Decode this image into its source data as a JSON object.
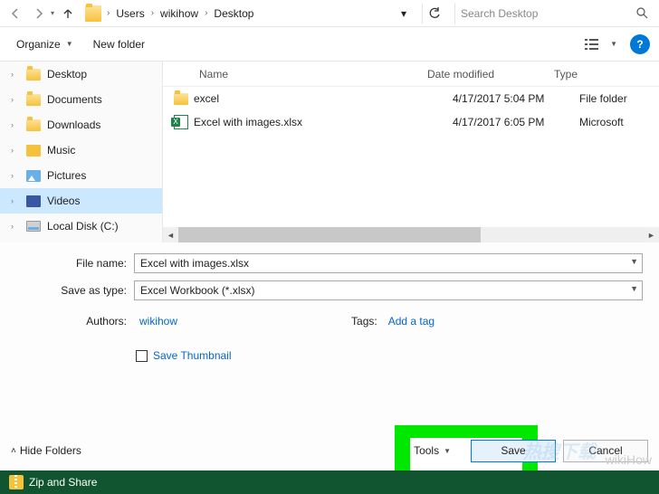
{
  "breadcrumbs": [
    "Users",
    "wikihow",
    "Desktop"
  ],
  "search": {
    "placeholder": "Search Desktop"
  },
  "cmdbar": {
    "organize": "Organize",
    "newfolder": "New folder"
  },
  "sidebar": {
    "items": [
      {
        "label": "Desktop",
        "icon": "folder",
        "expandable": true
      },
      {
        "label": "Documents",
        "icon": "folder",
        "expandable": true
      },
      {
        "label": "Downloads",
        "icon": "folder",
        "expandable": true
      },
      {
        "label": "Music",
        "icon": "music",
        "expandable": true
      },
      {
        "label": "Pictures",
        "icon": "pictures",
        "expandable": true
      },
      {
        "label": "Videos",
        "icon": "videos",
        "expandable": true,
        "selected": true
      },
      {
        "label": "Local Disk (C:)",
        "icon": "disk",
        "expandable": true
      }
    ]
  },
  "columns": {
    "name": "Name",
    "date": "Date modified",
    "type": "Type"
  },
  "rows": [
    {
      "icon": "folder",
      "name": "excel",
      "date": "4/17/2017 5:04 PM",
      "type": "File folder"
    },
    {
      "icon": "excel",
      "name": "Excel with images.xlsx",
      "date": "4/17/2017 6:05 PM",
      "type": "Microsoft"
    }
  ],
  "fields": {
    "filename_label": "File name:",
    "filename_value": "Excel with images.xlsx",
    "saveastype_label": "Save as type:",
    "saveastype_value": "Excel Workbook (*.xlsx)",
    "authors_label": "Authors:",
    "authors_value": "wikihow",
    "tags_label": "Tags:",
    "tags_value": "Add a tag",
    "save_thumbnail": "Save Thumbnail"
  },
  "bottom": {
    "hide_folders": "Hide Folders",
    "tools": "Tools",
    "save": "Save",
    "cancel": "Cancel"
  },
  "taskbar": {
    "zip": "Zip and Share"
  },
  "watermark": "wikiHow"
}
